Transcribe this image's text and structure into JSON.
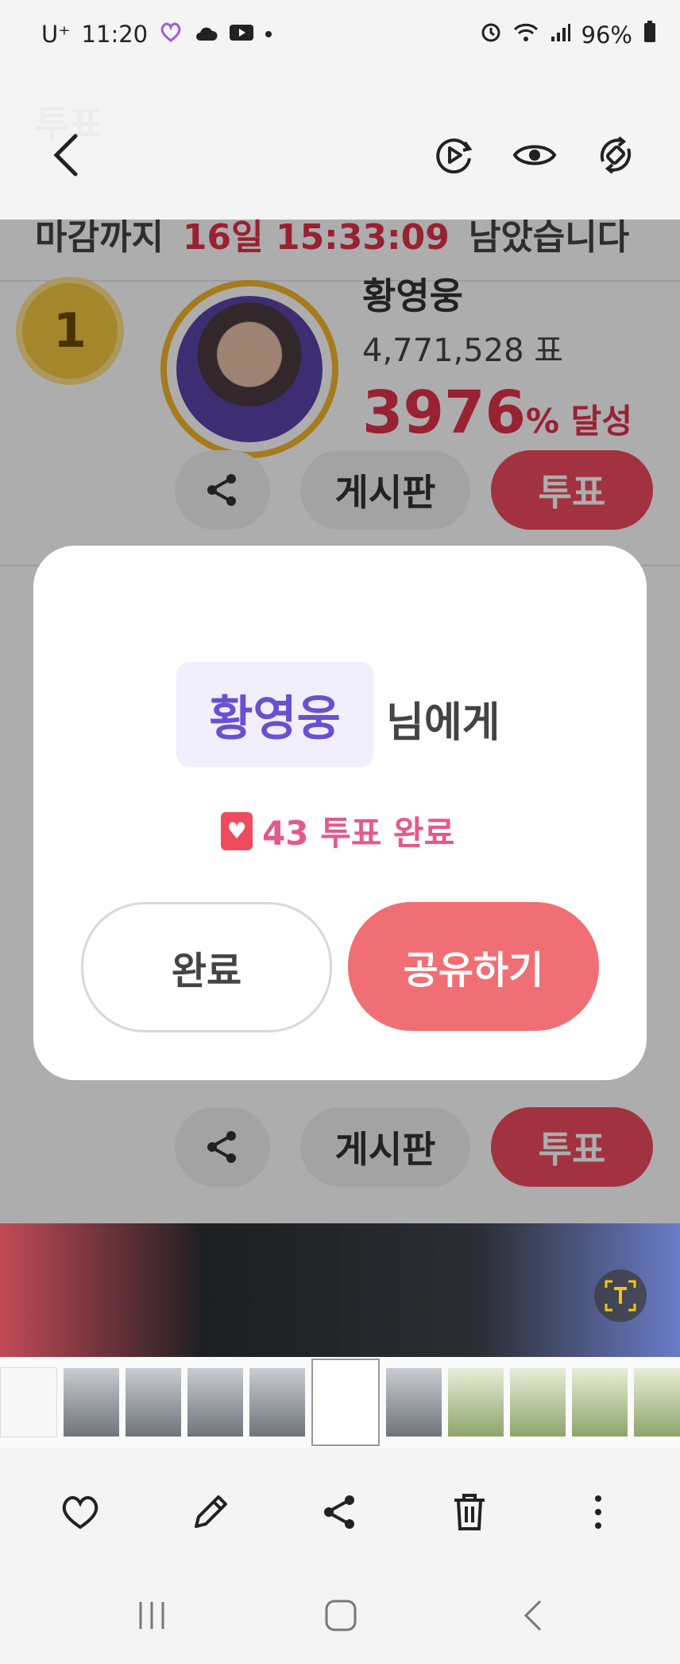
{
  "status_bar": {
    "carrier": "U⁺",
    "time": "11:20",
    "battery": "96%",
    "left_icons": [
      "heart-app-icon",
      "cloud-icon",
      "youtube-icon"
    ],
    "right_icons": [
      "alarm-icon",
      "wifi-icon",
      "signal-icon",
      "battery-icon"
    ]
  },
  "viewer_header": {
    "ghost_title": "투표",
    "icons": [
      "back-icon",
      "motion-photo-icon",
      "eye-icon",
      "rotate-icon"
    ]
  },
  "background_page": {
    "deadline_prefix": "마감까지",
    "deadline_time": "16일 15:33:09",
    "deadline_suffix": "남았습니다",
    "entry": {
      "rank": "1",
      "name": "황영웅",
      "votes": "4,771,528 표",
      "percent": "3976",
      "percent_suffix": "% 달성",
      "board_label": "게시판",
      "vote_label": "투표"
    },
    "entry2": {
      "board_label": "게시판",
      "vote_label": "투표"
    }
  },
  "modal": {
    "name": "황영웅",
    "suffix": "님에게",
    "voted_text": "43 투표 완료",
    "done_button": "완료",
    "share_button": "공유하기"
  },
  "toolbar_icons": [
    "heart-icon",
    "edit-icon",
    "share-icon",
    "trash-icon",
    "more-icon"
  ],
  "nav_icons": [
    "recents-icon",
    "home-icon",
    "back-nav-icon"
  ],
  "colors": {
    "accent_red": "#ef4b5e",
    "share_button": "#ef6f74",
    "name_purple": "#6a4fd0",
    "vote_pink": "#e35a8c"
  }
}
